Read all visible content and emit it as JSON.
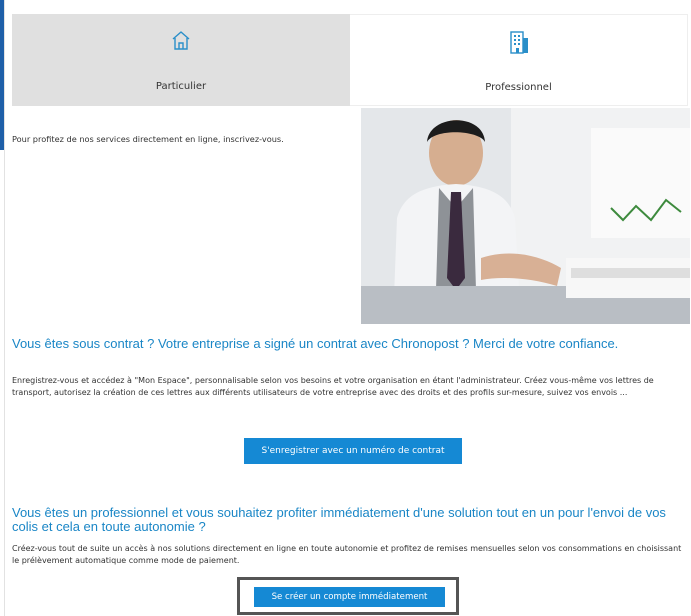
{
  "tabs": [
    {
      "label": "Particulier",
      "icon": "home-icon",
      "active": true
    },
    {
      "label": "Professionnel",
      "icon": "building-icon",
      "active": false
    }
  ],
  "intro_text": "Pour profitez de nos services directement en ligne, inscrivez-vous.",
  "contract": {
    "heading": "Vous êtes sous contrat ? Votre entreprise a signé un contrat avec Chronopost ? Merci de votre confiance.",
    "body": "Enregistrez-vous et accédez à \"Mon Espace\", personnalisable selon vos besoins et votre organisation en étant l'administrateur. Créez vous-même vos lettres de transport, autorisez la création de ces lettres aux différents utilisateurs de votre entreprise avec des droits et des profils sur-mesure, suivez vos envois ...",
    "button_label": "S'enregistrer avec un numéro de contrat"
  },
  "professional": {
    "heading": "Vous êtes un professionnel et vous souhaitez profiter immédiatement d'une solution tout en un pour l'envoi de vos colis et cela en toute autonomie ?",
    "body": "Créez-vous tout de suite un accès à nos solutions directement en ligne en toute autonomie et profitez de remises mensuelles selon vos consommations en choisissant le prélèvement automatique comme mode de paiement.",
    "button_label": "Se créer un compte immédiatement"
  },
  "colors": {
    "accent_blue": "#1a86c6",
    "button_blue": "#1589d4",
    "side_blue": "#1f5fa8",
    "tab_active_bg": "#e0e0e0"
  }
}
